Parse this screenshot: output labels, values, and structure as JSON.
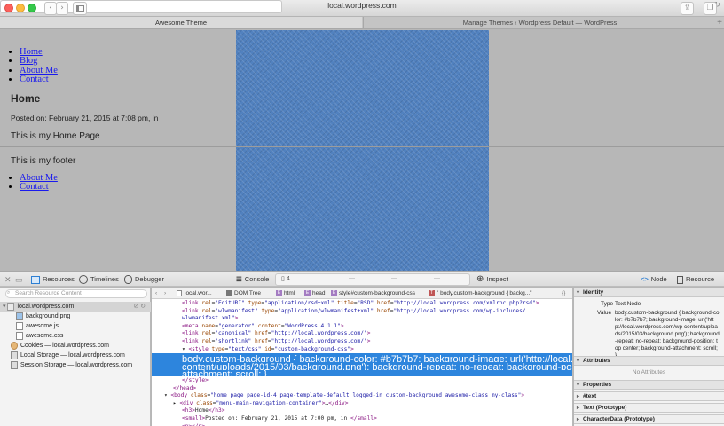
{
  "browser": {
    "url": "local.wordpress.com",
    "tabs": [
      {
        "label": "Awesome Theme"
      },
      {
        "label": "Manage Themes ‹ Wordpress Default — WordPress"
      }
    ]
  },
  "page": {
    "nav": [
      "Home",
      "Blog",
      "About Me",
      "Contact"
    ],
    "heading": "Home",
    "posted": "Posted on: February 21, 2015 at 7:08 pm, in",
    "body_text": "This is my Home Page",
    "footer_text": "This is my footer",
    "footer_nav": [
      "About Me",
      "Contact"
    ],
    "background_color": "#b7b7b7"
  },
  "inspector": {
    "toolbar": {
      "resources": "Resources",
      "timelines": "Timelines",
      "debugger": "Debugger",
      "console": "Console",
      "count": "4",
      "dashes": [
        "—",
        "—",
        "—"
      ],
      "inspect": "Inspect",
      "node": "Node",
      "resource": "Resource"
    },
    "left": {
      "search_placeholder": "Search Resource Content",
      "items": [
        "local.wordpress.com",
        "background.png",
        "awesome.js",
        "awesome.css",
        "Cookies — local.wordpress.com",
        "Local Storage — local.wordpress.com",
        "Session Storage — local.wordpress.com"
      ]
    },
    "breadcrumb": [
      "local.wor...",
      "DOM Tree",
      "html",
      "head",
      "style#custom-background-css",
      "\" body.custom-background { backg...\""
    ],
    "code_lines": [
      {
        "indent": 2,
        "html": "<span class=\"tg\">&lt;link</span> <span class=\"at\">rel</span>=<span class=\"av\">\"EditURI\"</span> <span class=\"at\">type</span>=<span class=\"av\">\"application/rsd+xml\"</span> <span class=\"at\">title</span>=<span class=\"av\">\"RSD\"</span> <span class=\"at\">href</span>=<span class=\"av\">\"http://local.wordpress.com/xmlrpc.php?rsd\"</span><span class=\"tg\">&gt;</span>"
      },
      {
        "indent": 2,
        "html": "<span class=\"tg\">&lt;link</span> <span class=\"at\">rel</span>=<span class=\"av\">\"wlwmanifest\"</span> <span class=\"at\">type</span>=<span class=\"av\">\"application/wlwmanifest+xml\"</span> <span class=\"at\">href</span>=<span class=\"av\">\"http://local.wordpress.com/wp-includes/</span>"
      },
      {
        "indent": 2,
        "html": "<span class=\"av\">wlwmanifest.xml\"</span><span class=\"tg\">&gt;</span>"
      },
      {
        "indent": 2,
        "html": "<span class=\"tg\">&lt;meta</span> <span class=\"at\">name</span>=<span class=\"av\">\"generator\"</span> <span class=\"at\">content</span>=<span class=\"av\">\"WordPress 4.1.1\"</span><span class=\"tg\">&gt;</span>"
      },
      {
        "indent": 2,
        "html": "<span class=\"tg\">&lt;link</span> <span class=\"at\">rel</span>=<span class=\"av\">\"canonical\"</span> <span class=\"at\">href</span>=<span class=\"av\">\"http://local.wordpress.com/\"</span><span class=\"tg\">&gt;</span>"
      },
      {
        "indent": 2,
        "html": "<span class=\"tg\">&lt;link</span> <span class=\"at\">rel</span>=<span class=\"av\">\"shortlink\"</span> <span class=\"at\">href</span>=<span class=\"av\">\"http://local.wordpress.com/\"</span><span class=\"tg\">&gt;</span>"
      },
      {
        "indent": 2,
        "html": "▾ <span class=\"tg\">&lt;style</span> <span class=\"at\">type</span>=<span class=\"av\">\"text/css\"</span> <span class=\"at\">id</span>=<span class=\"av\">\"custom-background-css\"</span><span class=\"tg\">&gt;</span>"
      }
    ],
    "selected_lines": [
      "body.custom-background { background-color: #b7b7b7; background-image: url('http://local.wordpress.com/wp-",
      "content/uploads/2015/03/background.png'); background-repeat: no-repeat; background-position: top center; background-",
      "attachment: scroll; }"
    ],
    "code_lines_after": [
      {
        "indent": 2,
        "html": "<span class=\"tg\">&lt;/style&gt;</span>"
      },
      {
        "indent": 1,
        "html": "<span class=\"tg\">&lt;/head&gt;</span>"
      },
      {
        "indent": 0,
        "html": "▾ <span class=\"tg\">&lt;body</span> <span class=\"at\">class</span>=<span class=\"av\">\"home page page-id-4 page-template-default logged-in custom-background awesome-class my-class\"</span><span class=\"tg\">&gt;</span>"
      },
      {
        "indent": 1,
        "html": "▸ <span class=\"tg\">&lt;div</span> <span class=\"at\">class</span>=<span class=\"av\">\"menu-main-navigation-container\"</span><span class=\"tg\">&gt;</span>…<span class=\"tg\">&lt;/div&gt;</span>"
      },
      {
        "indent": 2,
        "html": "<span class=\"tg\">&lt;h3&gt;</span>Home<span class=\"tg\">&lt;/h3&gt;</span>"
      },
      {
        "indent": 2,
        "html": "<span class=\"tg\">&lt;small&gt;</span>Posted on: February 21, 2015 at 7:00 pm, in <span class=\"tg\">&lt;/small&gt;</span>"
      },
      {
        "indent": 2,
        "html": "<span class=\"tg\">&lt;p&gt;&lt;/p&gt;</span>"
      },
      {
        "indent": 2,
        "html": "<span class=\"tg\">&lt;p&gt;</span>This is my Home Page<span class=\"tg\">&lt;/p&gt;</span>"
      }
    ],
    "right": {
      "identity_label": "Identity",
      "type_label": "Type",
      "type_value": "Text Node",
      "value_label": "Value",
      "value_text": "body.custom-background { background-color: #b7b7b7; background-image: url('http://local.wordpress.com/wp-content/uploads/2015/03/background.png'); background-repeat: no-repeat; background-position: top center; background-attachment: scroll; }",
      "attributes_label": "Attributes",
      "no_attributes": "No Attributes",
      "properties_label": "Properties",
      "props": [
        "#text",
        "Text (Prototype)",
        "CharacterData (Prototype)"
      ]
    },
    "colors": {
      "selection": "#2d85dd",
      "tag": "#881280",
      "attr": "#994500",
      "value": "#1a1aa6"
    }
  }
}
